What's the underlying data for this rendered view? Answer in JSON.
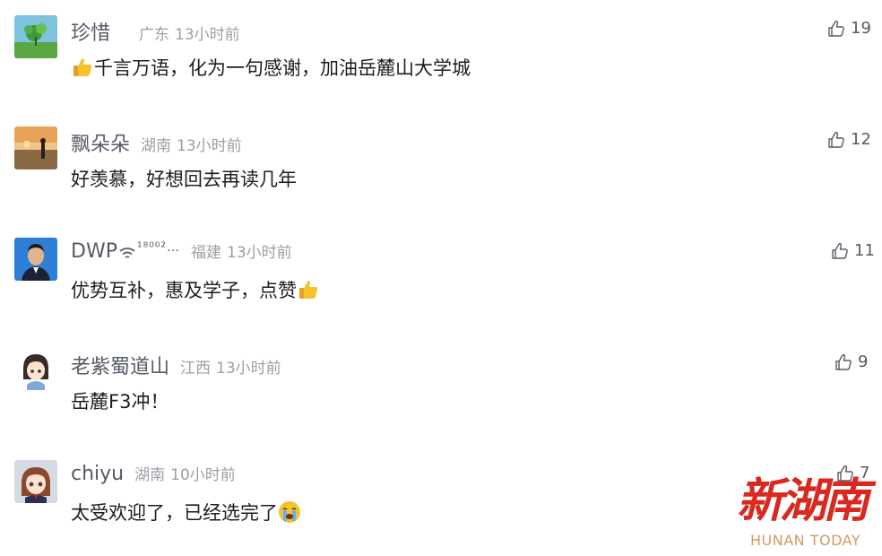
{
  "comments": [
    {
      "username": "珍惜",
      "username_suffix": "",
      "location": "广东",
      "time": "13小时前",
      "text": "千言万语，化为一句感谢，加油岳麓山大学城",
      "likes": "19",
      "avatar": "green-landscape-avatar"
    },
    {
      "username": "飘朵朵",
      "username_suffix": "",
      "location": "湖南",
      "time": "13小时前",
      "text": "好羡慕，好想回去再读几年",
      "likes": "12",
      "avatar": "sunset-beach-avatar"
    },
    {
      "username": "DWP",
      "username_suffix": "¹⁸⁰⁰²…",
      "location": "福建",
      "time": "13小时前",
      "text": "优势互补，惠及学子，点赞",
      "likes": "11",
      "avatar": "portrait-photo-avatar"
    },
    {
      "username": "老紫蜀道山",
      "username_suffix": "",
      "location": "江西",
      "time": "13小时前",
      "text": "岳麓F3冲！",
      "likes": "9",
      "avatar": "cartoon-girl-avatar"
    },
    {
      "username": "chiyu",
      "username_suffix": "",
      "location": "湖南",
      "time": "10小时前",
      "text": "太受欢迎了，已经选完了",
      "likes": "7",
      "avatar": "anime-character-avatar"
    }
  ],
  "watermark": {
    "title": "新湖南",
    "subtitle": "HUNAN TODAY"
  },
  "colors": {
    "username": "#555a66",
    "meta": "#9b9ea6",
    "text": "#1e1e1e",
    "brand_red": "#d8281f",
    "brand_gold": "#d7985c"
  }
}
